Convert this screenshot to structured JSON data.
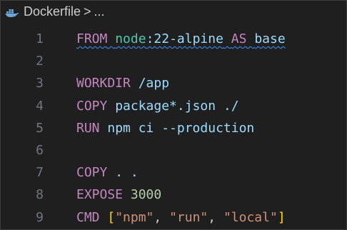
{
  "breadcrumb": {
    "file": "Dockerfile",
    "separator": ">",
    "more": "..."
  },
  "lines": [
    {
      "num": "1",
      "parts": [
        {
          "t": "FROM",
          "c": "kw",
          "sq": true
        },
        {
          "t": " ",
          "c": "plain",
          "sq": true
        },
        {
          "t": "node",
          "c": "img",
          "sq": true
        },
        {
          "t": ":22-alpine",
          "c": "txt",
          "sq": true
        },
        {
          "t": " ",
          "c": "plain",
          "sq": true
        },
        {
          "t": "AS",
          "c": "kw",
          "sq": true
        },
        {
          "t": " ",
          "c": "plain",
          "sq": true
        },
        {
          "t": "base",
          "c": "txt",
          "sq": true
        }
      ]
    },
    {
      "num": "2",
      "parts": []
    },
    {
      "num": "3",
      "parts": [
        {
          "t": "WORKDIR",
          "c": "kw"
        },
        {
          "t": " /app",
          "c": "txt"
        }
      ]
    },
    {
      "num": "4",
      "parts": [
        {
          "t": "COPY",
          "c": "kw"
        },
        {
          "t": " package*.json ./",
          "c": "txt"
        }
      ]
    },
    {
      "num": "5",
      "parts": [
        {
          "t": "RUN",
          "c": "kw"
        },
        {
          "t": " npm ci --production",
          "c": "txt"
        }
      ]
    },
    {
      "num": "6",
      "parts": []
    },
    {
      "num": "7",
      "parts": [
        {
          "t": "COPY",
          "c": "kw"
        },
        {
          "t": " . .",
          "c": "txt"
        }
      ]
    },
    {
      "num": "8",
      "parts": [
        {
          "t": "EXPOSE",
          "c": "kw"
        },
        {
          "t": " ",
          "c": "plain"
        },
        {
          "t": "3000",
          "c": "num"
        }
      ]
    },
    {
      "num": "9",
      "parts": [
        {
          "t": "CMD",
          "c": "kw"
        },
        {
          "t": " ",
          "c": "plain"
        },
        {
          "t": "[",
          "c": "brk"
        },
        {
          "t": "\"npm\"",
          "c": "str"
        },
        {
          "t": ", ",
          "c": "plain"
        },
        {
          "t": "\"run\"",
          "c": "str"
        },
        {
          "t": ", ",
          "c": "plain"
        },
        {
          "t": "\"local\"",
          "c": "str"
        },
        {
          "t": "]",
          "c": "brk"
        }
      ]
    }
  ],
  "icons": {
    "file": "docker-whale-icon"
  },
  "colors": {
    "background": "#1f1f1f",
    "keyword": "#c586c0",
    "image": "#4ec9b0",
    "text": "#9cdcfe",
    "string": "#ce9178",
    "number": "#b5cea8",
    "bracket": "#ffd700",
    "line_number": "#6e7681",
    "squiggle": "#3794ff"
  }
}
